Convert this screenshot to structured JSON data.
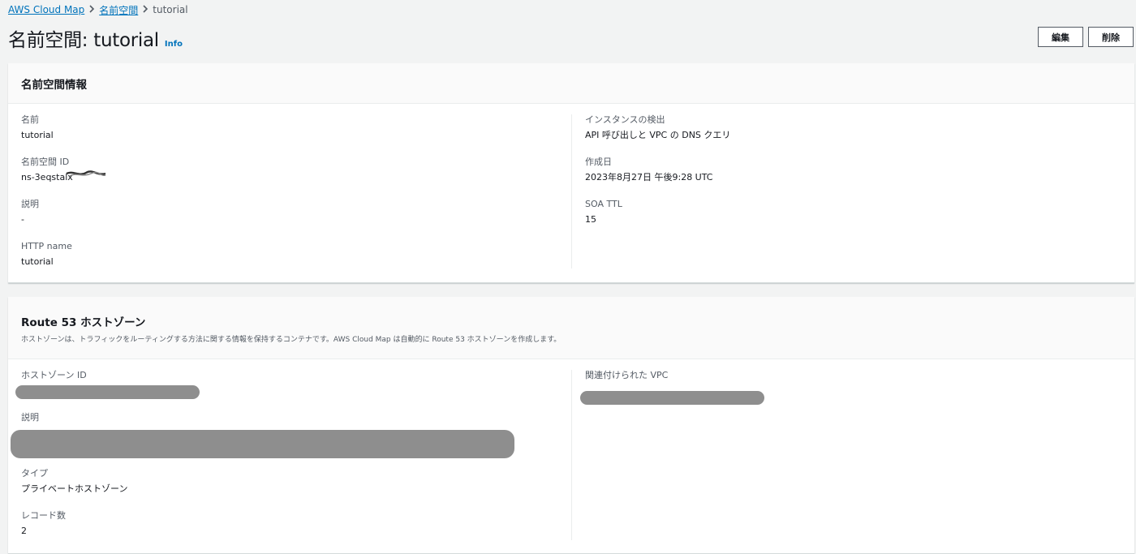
{
  "breadcrumb": {
    "items": [
      "AWS Cloud Map",
      "名前空間"
    ],
    "current": "tutorial"
  },
  "header": {
    "title": "名前空間: tutorial",
    "info": "Info",
    "edit_label": "編集",
    "delete_label": "削除"
  },
  "namespace_panel": {
    "title": "名前空間情報",
    "left": [
      {
        "label": "名前",
        "value": "tutorial"
      },
      {
        "label": "名前空間 ID",
        "value": "ns-3eqstalx"
      },
      {
        "label": "説明",
        "value": "-"
      },
      {
        "label": "HTTP name",
        "value": "tutorial"
      }
    ],
    "right": [
      {
        "label": "インスタンスの検出",
        "value": "API 呼び出しと VPC の DNS クエリ"
      },
      {
        "label": "作成日",
        "value": "2023年8月27日 午後9:28 UTC"
      },
      {
        "label": "SOA TTL",
        "value": "15"
      }
    ]
  },
  "route53_panel": {
    "title": "Route 53 ホストゾーン",
    "description": "ホストゾーンは、トラフィックをルーティングする方法に関する情報を保持するコンテナです。AWS Cloud Map は自動的に Route 53 ホストゾーンを作成します。",
    "left": [
      {
        "label": "ホストゾーン ID",
        "value": ""
      },
      {
        "label": "説明",
        "value": ""
      },
      {
        "label": "タイプ",
        "value": "プライベートホストゾーン"
      },
      {
        "label": "レコード数",
        "value": "2"
      }
    ],
    "right": [
      {
        "label": "関連付けられた VPC",
        "value": ""
      }
    ]
  }
}
